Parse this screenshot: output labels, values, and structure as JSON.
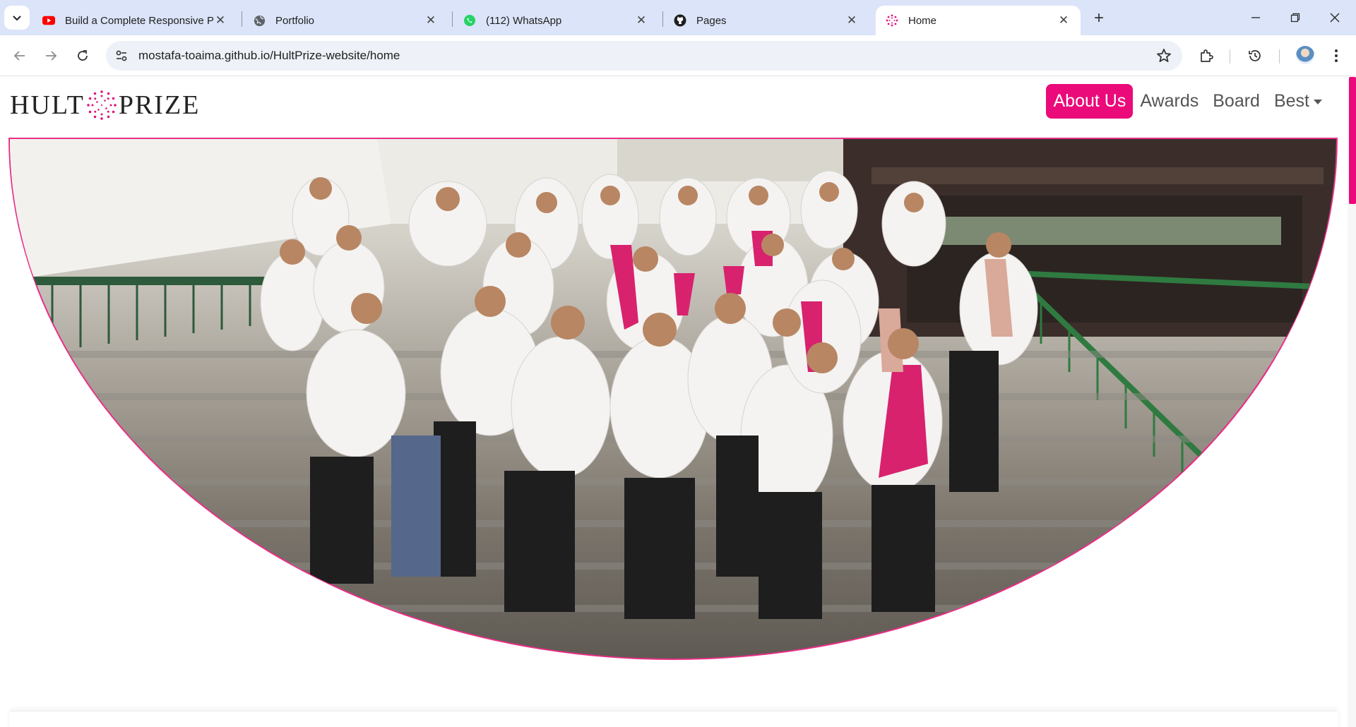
{
  "browser": {
    "tabs": [
      {
        "title": "Build a Complete Responsive Pc",
        "favicon": "youtube-icon"
      },
      {
        "title": "Portfolio",
        "favicon": "globe-icon"
      },
      {
        "title": "(112) WhatsApp",
        "favicon": "whatsapp-icon"
      },
      {
        "title": "Pages",
        "favicon": "github-icon"
      },
      {
        "title": "Home",
        "favicon": "hultprize-icon",
        "active": true
      }
    ],
    "address": "mostafa-toaima.github.io/HultPrize-website/home"
  },
  "site": {
    "brand_left": "HULT",
    "brand_right": "PRIZE",
    "nav": [
      {
        "label": "About Us",
        "active": true
      },
      {
        "label": "Awards"
      },
      {
        "label": "Board"
      },
      {
        "label": "Best",
        "dropdown": true
      }
    ],
    "accent": "#ea0a7a",
    "hero_image": "group-photo"
  }
}
